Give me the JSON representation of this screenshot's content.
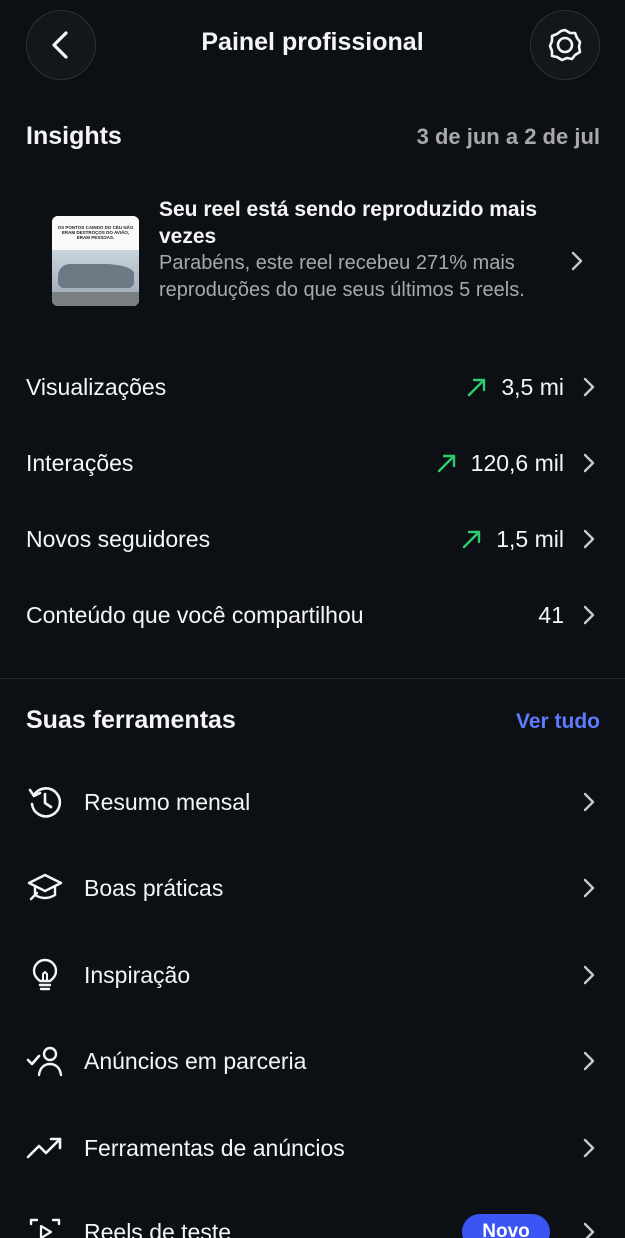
{
  "header": {
    "title": "Painel profissional"
  },
  "insights": {
    "title": "Insights",
    "date_range": "3 de jun a 2 de jul",
    "reel_card": {
      "thumb_text": "OS PONTOS CAINDO DO CÉU NÃO ERAM DESTROÇOS DO AVIÃO, ERAM PESSOAS.",
      "title": "Seu reel está sendo reproduzido mais vezes",
      "body": "Parabéns, este reel recebeu 271% mais reproduções do que seus últimos 5 reels."
    },
    "metrics": [
      {
        "label": "Visualizações",
        "value": "3,5 mi",
        "trend": "up"
      },
      {
        "label": "Interações",
        "value": "120,6 mil",
        "trend": "up"
      },
      {
        "label": "Novos seguidores",
        "value": "1,5 mil",
        "trend": "up"
      },
      {
        "label": "Conteúdo que você compartilhou",
        "value": "41",
        "trend": "none"
      }
    ]
  },
  "tools": {
    "title": "Suas ferramentas",
    "see_all": "Ver tudo",
    "items": [
      {
        "label": "Resumo mensal",
        "icon": "history-icon"
      },
      {
        "label": "Boas práticas",
        "icon": "graduation-cap-icon"
      },
      {
        "label": "Inspiração",
        "icon": "lightbulb-icon"
      },
      {
        "label": "Anúncios em parceria",
        "icon": "person-check-icon"
      },
      {
        "label": "Ferramentas de anúncios",
        "icon": "trending-up-icon"
      },
      {
        "label": "Reels de teste",
        "icon": "test-reel-icon",
        "badge": "Novo"
      }
    ]
  },
  "colors": {
    "background": "#0c1014",
    "accent": "#5d7bff",
    "trend_up": "#2ecc71",
    "badge": "#3a55f4"
  }
}
